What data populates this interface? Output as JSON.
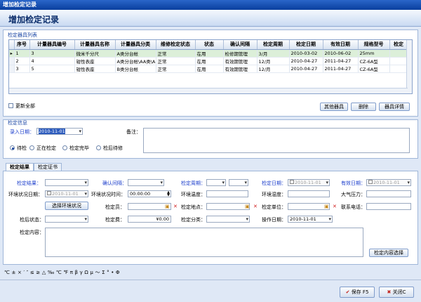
{
  "window": {
    "title": "增加检定记录",
    "header": "增加检定记录"
  },
  "equipment": {
    "section_label": "检定器具列表",
    "columns": [
      "序号",
      "计量器具编号",
      "计量器具名称",
      "计量器具分类",
      "维修检定状态",
      "状态",
      "确认间隔",
      "检定周期",
      "检定日期",
      "有效日期",
      "规格型号",
      "检定"
    ],
    "rows": [
      [
        "1",
        "3",
        "微米千分尺",
        "A类分台帐",
        "正常",
        "在用",
        "检修期管理",
        "3/月",
        "2010-03-02",
        "2010-06-02",
        "25mm",
        ""
      ],
      [
        "2",
        "4",
        "钳性表座",
        "A类分台帐\\AA类\\A",
        "正常",
        "在用",
        "有效期管理",
        "12/月",
        "2010-04-27",
        "2011-04-27",
        "CZ-6A型",
        ""
      ],
      [
        "3",
        "5",
        "钳性表座",
        "B类分台帐",
        "正常",
        "在用",
        "有效期管理",
        "12/月",
        "2010-04-27",
        "2011-04-27",
        "CZ-6A型",
        ""
      ]
    ],
    "update_all": "更新全部",
    "btn_other": "其他器具",
    "btn_delete": "删除",
    "btn_detail": "器具详情"
  },
  "info": {
    "section_label": "检定信息",
    "entry_date_label": "录入日期：",
    "entry_date": "2010-11-01",
    "remark_label": "备注：",
    "radios": [
      "待检",
      "正在检定",
      "检定完毕",
      "检后待修"
    ],
    "radio_selected": 0
  },
  "tabs": [
    "检定结果",
    "检定证书"
  ],
  "result": {
    "verify_result": "检定结果：",
    "confirm_interval": "确认间隔：",
    "verify_period": "检定周期：",
    "verify_date": "检定日期：",
    "verify_date_val": "2010-11-01",
    "valid_date": "有效日期：",
    "valid_date_val": "2010-11-01",
    "env_date": "环境状况日期：",
    "env_date_val": "2010-11-01",
    "env_time": "环境状况时间：",
    "env_time_val": "00:00:00",
    "env_temp": "环境温度：",
    "env_humidity": "环境湿度：",
    "air_pressure": "大气压力：",
    "select_env": "选择环境状况",
    "verifier": "检定员：",
    "location": "检定地点：",
    "unit": "检定单位：",
    "phone": "联系电话：",
    "after_status": "检后状态：",
    "fee": "检定费：",
    "fee_val": "¥0.00",
    "category": "检定分类：",
    "op_date": "操作日期：",
    "op_date_val": "2010-11-01",
    "content": "检定内容：",
    "content_btn": "检定内容选择"
  },
  "symbols": "℃ ± × ′ ″ ≤ ≥ △ ‰ ℃ ℉ π β γ Ω μ ～ Σ ° • Φ",
  "footer": {
    "save": "保存 F5",
    "close": "关闭C"
  }
}
